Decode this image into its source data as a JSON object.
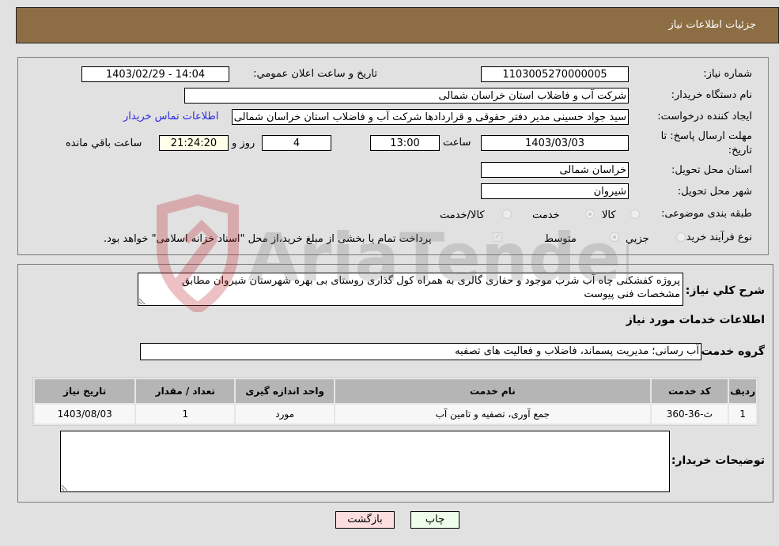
{
  "header": {
    "title": "جزئیات اطلاعات نیاز"
  },
  "form": {
    "need_number_label": "شماره نیاز:",
    "need_number": "1103005270000005",
    "announce_label": "تاریخ و ساعت اعلان عمومي:",
    "announce_value": "1403/02/29 - 14:04",
    "buyer_org_label": "نام دستگاه خریدار:",
    "buyer_org": "شرکت آب و فاضلاب استان خراسان شمالی",
    "creator_label": "ایجاد کننده درخواست:",
    "creator": "سید جواد حسینی مدیر دفتر حقوقی و قراردادها  شرکت آب و فاضلاب استان خراسان شمالی",
    "contact_link": "اطلاعات تماس خریدار",
    "deadline_label_line1": "مهلت ارسال پاسخ: تا",
    "deadline_label_line2": "تاریخ:",
    "deadline_date": "1403/03/03",
    "time_label": "ساعت",
    "deadline_time": "13:00",
    "days_value": "4",
    "days_label": "روز و",
    "remaining_time": "21:24:20",
    "remaining_label": "ساعت باقي مانده",
    "province_label": "استان محل تحویل:",
    "province": "خراسان شمالی",
    "city_label": "شهر محل تحویل:",
    "city": "شیروان",
    "category_label": "طبقه بندی موضوعی:",
    "category_options": [
      {
        "label": "کالا",
        "selected": false
      },
      {
        "label": "خدمت",
        "selected": true
      },
      {
        "label": "کالا/خدمت",
        "selected": false
      }
    ],
    "process_label": "نوع فرآیند خرید :",
    "process_options": [
      {
        "label": "جزيي",
        "selected": false
      },
      {
        "label": "متوسط",
        "selected": true
      }
    ],
    "treasury_checkbox_label": "پرداخت تمام یا بخشی از مبلغ خرید،از محل \"اسناد خزانه اسلامی\" خواهد بود.",
    "treasury_checked": true
  },
  "details": {
    "description_label": "شرح کلي نیاز:",
    "description": "پروژه کفشکنی چاه آب شرب موجود و حفاری گالری به همراه کول گذاری روستای بی بهره شهرستان شیروان مطابق مشخصات فنی پیوست",
    "services_heading": "اطلاعات خدمات مورد نیاز",
    "service_group_label": "گروه خدمت:",
    "service_group": "آب رسانی؛ مدیریت پسماند، فاضلاب و فعالیت های تصفیه",
    "table": {
      "headers": [
        "ردیف",
        "کد خدمت",
        "نام خدمت",
        "واحد اندازه گیری",
        "تعداد / مقدار",
        "تاریخ نیاز"
      ],
      "rows": [
        [
          "1",
          "ث-36-360",
          "جمع آوری، تصفیه و تامین آب",
          "مورد",
          "1",
          "1403/08/03"
        ]
      ]
    },
    "buyer_notes_label": "توضیحات خریدار:",
    "buyer_notes": ""
  },
  "buttons": {
    "print": "چاپ",
    "back": "بازگشت"
  },
  "watermark": {
    "text": "AriaTender.neT"
  }
}
